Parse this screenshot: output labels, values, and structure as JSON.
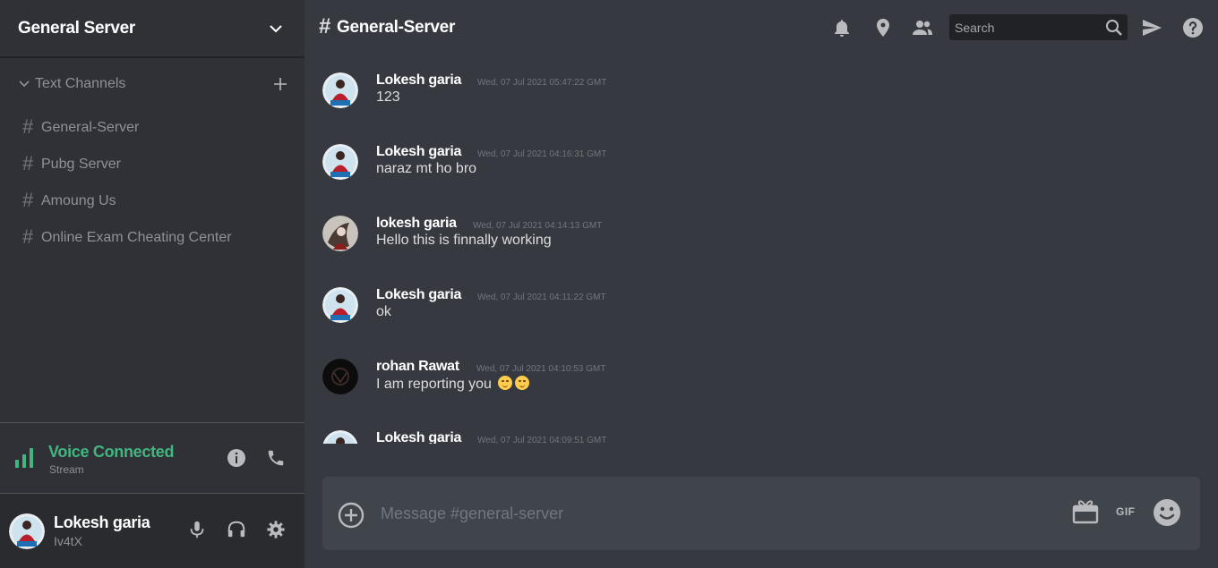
{
  "sidebar": {
    "server_name": "General Server",
    "category": {
      "label": "Text Channels"
    },
    "channels": [
      {
        "label": "General-Server"
      },
      {
        "label": "Pubg Server"
      },
      {
        "label": "Amoung Us"
      },
      {
        "label": "Online Exam Cheating Center"
      }
    ],
    "voice": {
      "title": "Voice Connected",
      "subtitle": "Stream"
    },
    "user": {
      "name": "Lokesh garia",
      "tag": "Iv4tX"
    }
  },
  "channel": {
    "hash": "#",
    "name": "General-Server"
  },
  "search": {
    "placeholder": "Search"
  },
  "messages": [
    {
      "author": "Lokesh garia",
      "time": "Wed, 07 Jul 2021 05:47:22 GMT",
      "text": "123"
    },
    {
      "author": "Lokesh garia",
      "time": "Wed, 07 Jul 2021 04:16:31 GMT",
      "text": "naraz mt ho bro"
    },
    {
      "author": "lokesh garia",
      "time": "Wed, 07 Jul 2021 04:14:13 GMT",
      "text": "Hello this is finnally working"
    },
    {
      "author": "Lokesh garia",
      "time": "Wed, 07 Jul 2021 04:11:22 GMT",
      "text": "ok"
    },
    {
      "author": "rohan Rawat",
      "time": "Wed, 07 Jul 2021 04:10:53 GMT",
      "text": "I am reporting you"
    },
    {
      "author": "Lokesh garia",
      "time": "Wed, 07 Jul 2021 04:09:51 GMT",
      "text": ""
    }
  ],
  "composer": {
    "placeholder": "Message #general-server",
    "gif_label": "GIF"
  },
  "colors": {
    "accent_green": "#43b581",
    "background": "#36393f",
    "sidebar": "#2f3136"
  }
}
